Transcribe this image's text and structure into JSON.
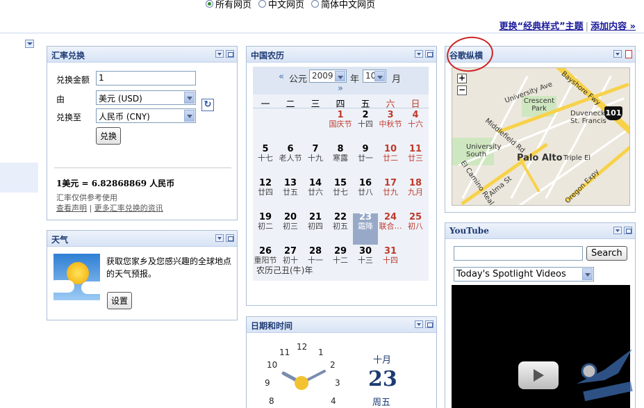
{
  "search_scope": {
    "options": [
      "所有网页",
      "中文网页",
      "简体中文网页"
    ],
    "selected": 0
  },
  "top_links": {
    "theme": "更换“经典样式”主题",
    "add": "添加内容 »"
  },
  "currency": {
    "title": "汇率兑换",
    "amount_label": "兑换金额",
    "amount_value": "1",
    "from_label": "由",
    "from_value": "美元 (USD)",
    "to_label": "兑换至",
    "to_value": "人民币 (CNY)",
    "convert_button": "兑换",
    "result": "1美元 = 6.82868869 人民币",
    "note": "汇率仅供参考使用",
    "link_disclaimer": "查看声明",
    "link_more": "更多汇率兑换的资讯"
  },
  "weather": {
    "title": "天气",
    "text": "获取您家乡及您感兴趣的全球地点的天气预报。",
    "button": "设置"
  },
  "calendar": {
    "title": "中国农历",
    "nav_prev": "«",
    "era_label": "公元",
    "year": "2009",
    "year_unit": "年",
    "month": "10",
    "month_unit": "月",
    "nav_next": "»",
    "weekdays": [
      "一",
      "二",
      "三",
      "四",
      "五",
      "六",
      "日"
    ],
    "weeks": [
      [
        null,
        null,
        null,
        {
          "d": "1",
          "l": "国庆节",
          "red": true
        },
        {
          "d": "2",
          "l": "十四"
        },
        {
          "d": "3",
          "l": "中秋节",
          "red": true
        },
        {
          "d": "4",
          "l": "十六",
          "red": true
        }
      ],
      [
        {
          "d": "5",
          "l": "十七"
        },
        {
          "d": "6",
          "l": "老人节"
        },
        {
          "d": "7",
          "l": "十九"
        },
        {
          "d": "8",
          "l": "寒露"
        },
        {
          "d": "9",
          "l": "廿一"
        },
        {
          "d": "10",
          "l": "廿二",
          "red": true
        },
        {
          "d": "11",
          "l": "廿三",
          "red": true
        }
      ],
      [
        {
          "d": "12",
          "l": "廿四"
        },
        {
          "d": "13",
          "l": "廿五"
        },
        {
          "d": "14",
          "l": "廿六"
        },
        {
          "d": "15",
          "l": "廿七"
        },
        {
          "d": "16",
          "l": "廿八"
        },
        {
          "d": "17",
          "l": "廿九",
          "red": true
        },
        {
          "d": "18",
          "l": "九月",
          "red": true
        }
      ],
      [
        {
          "d": "19",
          "l": "初二"
        },
        {
          "d": "20",
          "l": "初三"
        },
        {
          "d": "21",
          "l": "初四"
        },
        {
          "d": "22",
          "l": "初五"
        },
        {
          "d": "23",
          "l": "霜降",
          "today": true
        },
        {
          "d": "24",
          "l": "联合…",
          "red": true
        },
        {
          "d": "25",
          "l": "初八",
          "red": true
        }
      ],
      [
        {
          "d": "26",
          "l": "重阳节"
        },
        {
          "d": "27",
          "l": "初十"
        },
        {
          "d": "28",
          "l": "十一"
        },
        {
          "d": "29",
          "l": "十二"
        },
        {
          "d": "30",
          "l": "十三"
        },
        {
          "d": "31",
          "l": "十四",
          "red": true
        },
        null
      ]
    ],
    "footer": "农历己丑(牛)年"
  },
  "datetime": {
    "title": "日期和时间",
    "clock_numbers": [
      "12",
      "1",
      "2",
      "3",
      "4",
      "8",
      "9",
      "10",
      "11"
    ],
    "month": "十月",
    "day": "23",
    "weekday": "周五"
  },
  "map": {
    "title": "谷歌纵横",
    "labels": [
      "University Ave",
      "Bayshore Fwy",
      "Crescent Park",
      "Duveneck / St. Francis",
      "Middlefield Rd",
      "University South",
      "Palo Alto",
      "Triple El",
      "El Camino Real",
      "Alma St",
      "Oregon Expy"
    ],
    "zoom_in": "+",
    "zoom_out": "−",
    "route": "101"
  },
  "youtube": {
    "title": "YouTube",
    "search_button": "Search",
    "search_value": "",
    "channel": "Today's Spotlight Videos"
  },
  "colors": {
    "header_text": "#1d3a73",
    "link": "#1a1a9a",
    "holiday": "#c0392b",
    "today_bg": "#98a9c7"
  }
}
